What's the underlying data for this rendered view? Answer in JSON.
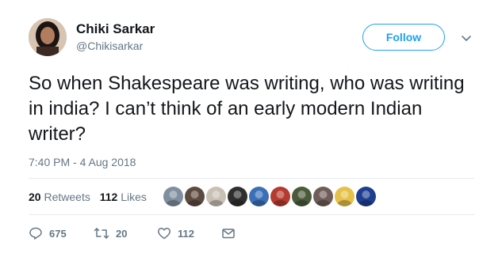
{
  "author": {
    "display_name": "Chiki Sarkar",
    "handle": "@Chikisarkar"
  },
  "follow_label": "Follow",
  "tweet_text": "So when Shakespeare was writing, who was writing in india? I can’t think of an early modern Indian writer?",
  "timestamp": "7:40 PM - 4 Aug 2018",
  "stats": {
    "retweets_count": "20",
    "retweets_label": "Retweets",
    "likes_count": "112",
    "likes_label": "Likes"
  },
  "liker_colors": [
    "#7f8fa0",
    "#5d4a3f",
    "#c9c0b5",
    "#2f2f2f",
    "#3b6fb6",
    "#b53a2f",
    "#4a5a3a",
    "#6e5d58",
    "#e6c14a",
    "#1e3f8f"
  ],
  "actions": {
    "reply_count": "675",
    "retweet_count": "20",
    "like_count": "112"
  },
  "colors": {
    "accent": "#1da1f2",
    "secondary_text": "#657786",
    "primary_text": "#14171a"
  },
  "icons": [
    "reply-icon",
    "retweet-icon",
    "heart-icon",
    "direct-message-icon",
    "chevron-down-icon"
  ]
}
